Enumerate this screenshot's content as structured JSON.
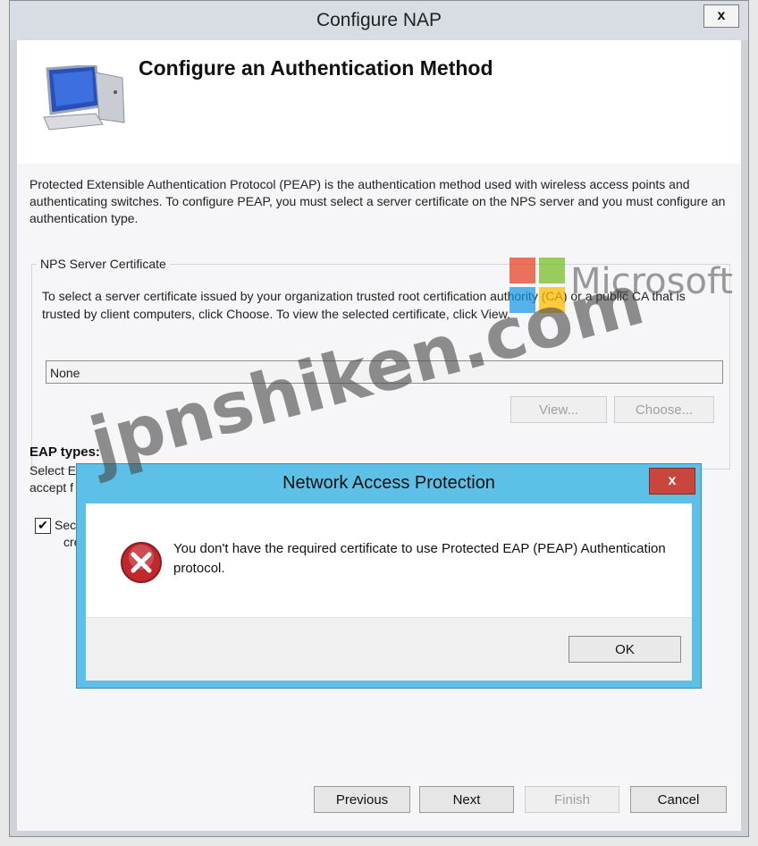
{
  "window": {
    "title": "Configure NAP",
    "close_label": "x"
  },
  "header": {
    "heading": "Configure an Authentication Method"
  },
  "description": "Protected Extensible Authentication Protocol (PEAP) is the authentication method used with wireless access points and authenticating switches. To configure PEAP, you must select a server certificate on the NPS server and you must configure an authentication type.",
  "server_certificate": {
    "legend": "NPS Server Certificate",
    "instructions": "To select a server certificate issued by your organization trusted root certification authority (CA) or a public CA that is trusted by client computers, click Choose. To view the selected certificate, click View.",
    "value": "None",
    "view_label": "View...",
    "choose_label": "Choose..."
  },
  "eap": {
    "title": "EAP types:",
    "line1": "Select E",
    "line2": "accept f",
    "checkbox_checked": true,
    "option_line1": "Secu",
    "option_line2": "cred"
  },
  "dialog": {
    "title": "Network Access Protection",
    "close_label": "x",
    "message": "You don't have the required certificate to use Protected EAP (PEAP) Authentication protocol.",
    "ok_label": "OK"
  },
  "wizard_buttons": {
    "previous": "Previous",
    "next": "Next",
    "finish": "Finish",
    "cancel": "Cancel"
  },
  "watermark": {
    "site": "jpnshiken.com",
    "brand": "Microsoft"
  },
  "colors": {
    "dialog_frame": "#5dc0e6",
    "error_red": "#c0282d",
    "close_red": "#c9463d"
  }
}
